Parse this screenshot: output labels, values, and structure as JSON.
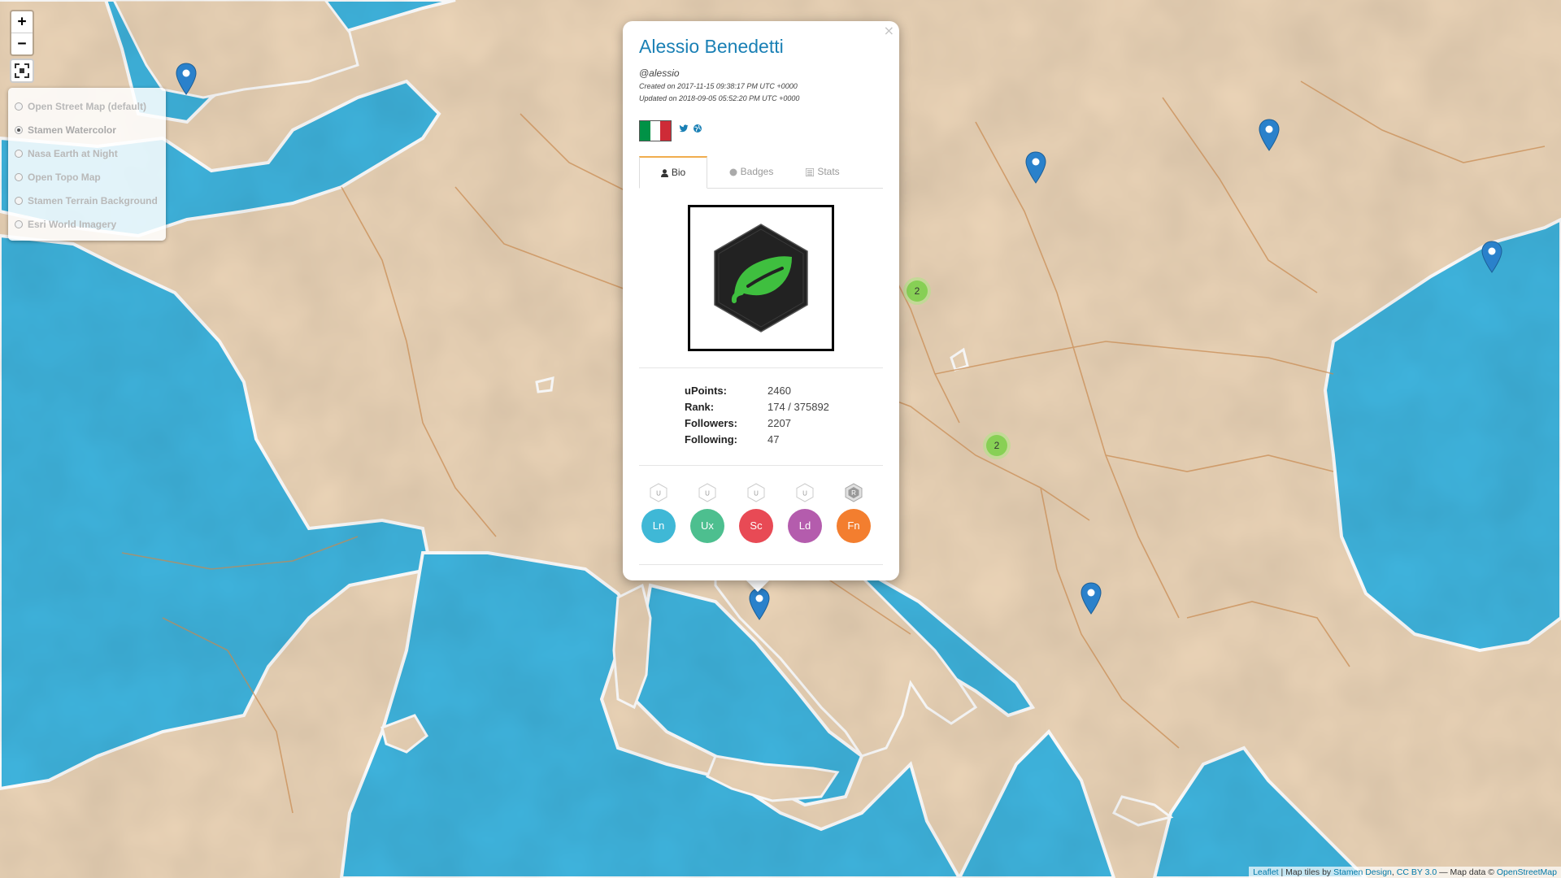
{
  "map": {
    "zoom_in": "+",
    "zoom_out": "−",
    "fullscreen_icon": "fullscreen-icon",
    "layers": [
      {
        "label": "Open Street Map (default)",
        "selected": false
      },
      {
        "label": "Stamen Watercolor",
        "selected": true
      },
      {
        "label": "Nasa Earth at Night",
        "selected": false
      },
      {
        "label": "Open Topo Map",
        "selected": false
      },
      {
        "label": "Stamen Terrain Background",
        "selected": false
      },
      {
        "label": "Esri World Imagery",
        "selected": false
      }
    ],
    "clusters": [
      {
        "count": "2"
      },
      {
        "count": "2"
      }
    ],
    "colors": {
      "land": "#ecd5b8",
      "sea": "#3fb5df",
      "border": "#c8894f",
      "marker": "#2a81cb"
    }
  },
  "popup": {
    "close": "×",
    "name": "Alessio Benedetti",
    "handle": "@alessio",
    "created": "Created on 2017-11-15 09:38:17 PM UTC +0000",
    "updated": "Updated on 2018-09-05 05:52:20 PM UTC +0000",
    "flag_colors": [
      "#009246",
      "#ffffff",
      "#ce2b37"
    ],
    "social_icons": [
      "twitter-icon",
      "globe-icon"
    ],
    "tabs": [
      {
        "label": "Bio",
        "icon": "user-icon",
        "active": true
      },
      {
        "label": "Badges",
        "icon": "circle-icon",
        "active": false
      },
      {
        "label": "Stats",
        "icon": "list-icon",
        "active": false
      }
    ],
    "badge_icon": "leaf-icon",
    "stats": [
      {
        "label": "uPoints:",
        "value": "2460"
      },
      {
        "label": "Rank:",
        "value": "174 / 375892"
      },
      {
        "label": "Followers:",
        "value": "2207"
      },
      {
        "label": "Following:",
        "value": "47"
      }
    ],
    "skills": [
      {
        "short": "Ln",
        "hex": "U",
        "color": "#3fb8d6"
      },
      {
        "short": "Ux",
        "hex": "U",
        "color": "#4dbf8f"
      },
      {
        "short": "Sc",
        "hex": "U",
        "color": "#e84a55"
      },
      {
        "short": "Ld",
        "hex": "U",
        "color": "#b45cad"
      },
      {
        "short": "Fn",
        "hex": "R",
        "color": "#f37e2f"
      }
    ]
  },
  "attribution": {
    "leaflet": "Leaflet",
    "sep1": " | Map tiles by ",
    "stamen": "Stamen Design",
    "sep2": ", ",
    "license": "CC BY 3.0",
    "sep3": " — Map data © ",
    "osm": "OpenStreetMap"
  }
}
